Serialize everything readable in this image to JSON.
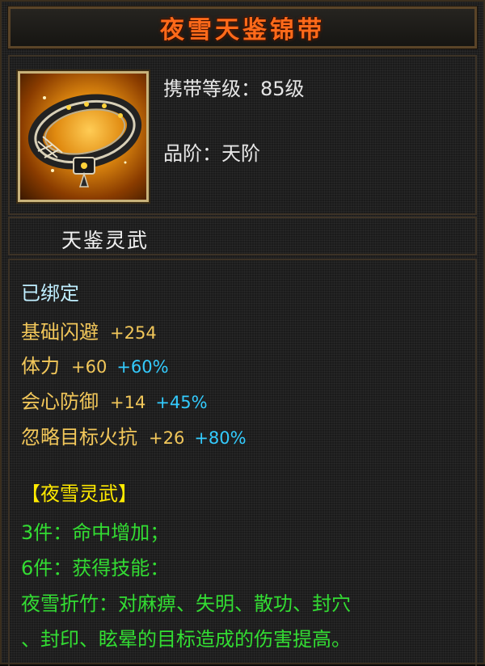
{
  "item": {
    "name": "夜雪天鉴锦带",
    "level_label": "携带等级：85级",
    "grade_label": "品阶：天阶",
    "subtitle": "天鉴灵武",
    "icon": "belt-icon"
  },
  "stats": {
    "bound": "已绑定",
    "attributes": [
      {
        "name": "基础闪避",
        "value": "+254",
        "percent": ""
      },
      {
        "name": "体力",
        "value": "+60",
        "percent": "+60%"
      },
      {
        "name": "会心防御",
        "value": "+14",
        "percent": "+45%"
      },
      {
        "name": "忽略目标火抗",
        "value": "+26",
        "percent": "+80%"
      }
    ]
  },
  "set": {
    "title": "【夜雪灵武】",
    "lines": [
      "3件：命中增加；",
      "6件：获得技能：",
      "夜雪折竹：对麻痹、失明、散功、封穴",
      "、封印、眩晕的目标造成的伤害提高。"
    ]
  },
  "colors": {
    "title": "#ff6a1a",
    "attribute": "#f2c75a",
    "percent": "#33ccff",
    "bound": "#bfeeff",
    "set_title": "#ffea00",
    "set_text": "#33dd33"
  }
}
